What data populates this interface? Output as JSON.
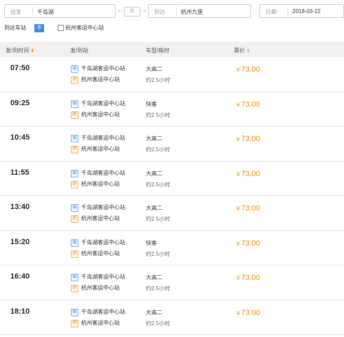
{
  "search": {
    "from_label": "出发",
    "from_value": "千岛湖",
    "swap_label": "换",
    "to_label": "到达",
    "to_value": "杭州九堡",
    "date_label": "日期",
    "date_value": "2018-03-22"
  },
  "filter": {
    "label": "到达车站",
    "no_limit": "不限",
    "option_label": "杭州客运中心站"
  },
  "table": {
    "headers": {
      "time": "发/到时间",
      "stations": "发/到站",
      "type_duration": "车型/耗时",
      "price": "票价"
    },
    "rows": [
      {
        "time": "07:50",
        "from_station": "千岛湖客运中心站",
        "to_station": "杭州客运中心站",
        "type": "大高二",
        "duration": "约2.5小时",
        "currency": "¥",
        "price": "73.00"
      },
      {
        "time": "09:25",
        "from_station": "千岛湖客运中心站",
        "to_station": "杭州客运中心站",
        "type": "快客",
        "duration": "约2.5小时",
        "currency": "¥",
        "price": "73.00"
      },
      {
        "time": "10:45",
        "from_station": "千岛湖客运中心站",
        "to_station": "杭州客运中心站",
        "type": "大高二",
        "duration": "约2.5小时",
        "currency": "¥",
        "price": "73.00"
      },
      {
        "time": "11:55",
        "from_station": "千岛湖客运中心站",
        "to_station": "杭州客运中心站",
        "type": "大高二",
        "duration": "约2.5小时",
        "currency": "¥",
        "price": "73.00"
      },
      {
        "time": "13:40",
        "from_station": "千岛湖客运中心站",
        "to_station": "杭州客运中心站",
        "type": "大高二",
        "duration": "约2.5小时",
        "currency": "¥",
        "price": "73.00"
      },
      {
        "time": "15:20",
        "from_station": "千岛湖客运中心站",
        "to_station": "杭州客运中心站",
        "type": "快客",
        "duration": "约2.5小时",
        "currency": "¥",
        "price": "73.00"
      },
      {
        "time": "16:40",
        "from_station": "千岛湖客运中心站",
        "to_station": "杭州客运中心站",
        "type": "大高二",
        "duration": "约2.5小时",
        "currency": "¥",
        "price": "73.00"
      },
      {
        "time": "18:10",
        "from_station": "千岛湖客运中心站",
        "to_station": "杭州客运中心站",
        "type": "大高二",
        "duration": "约2.5小时",
        "currency": "¥",
        "price": "73.00"
      }
    ],
    "start_badge": "始",
    "end_badge": "终"
  },
  "colors": {
    "accent_blue": "#3a85e5",
    "price_orange": "#f08c00"
  },
  "icons": {
    "sort_asc": "arrow-up-icon",
    "sort_default": "sort-icon"
  }
}
